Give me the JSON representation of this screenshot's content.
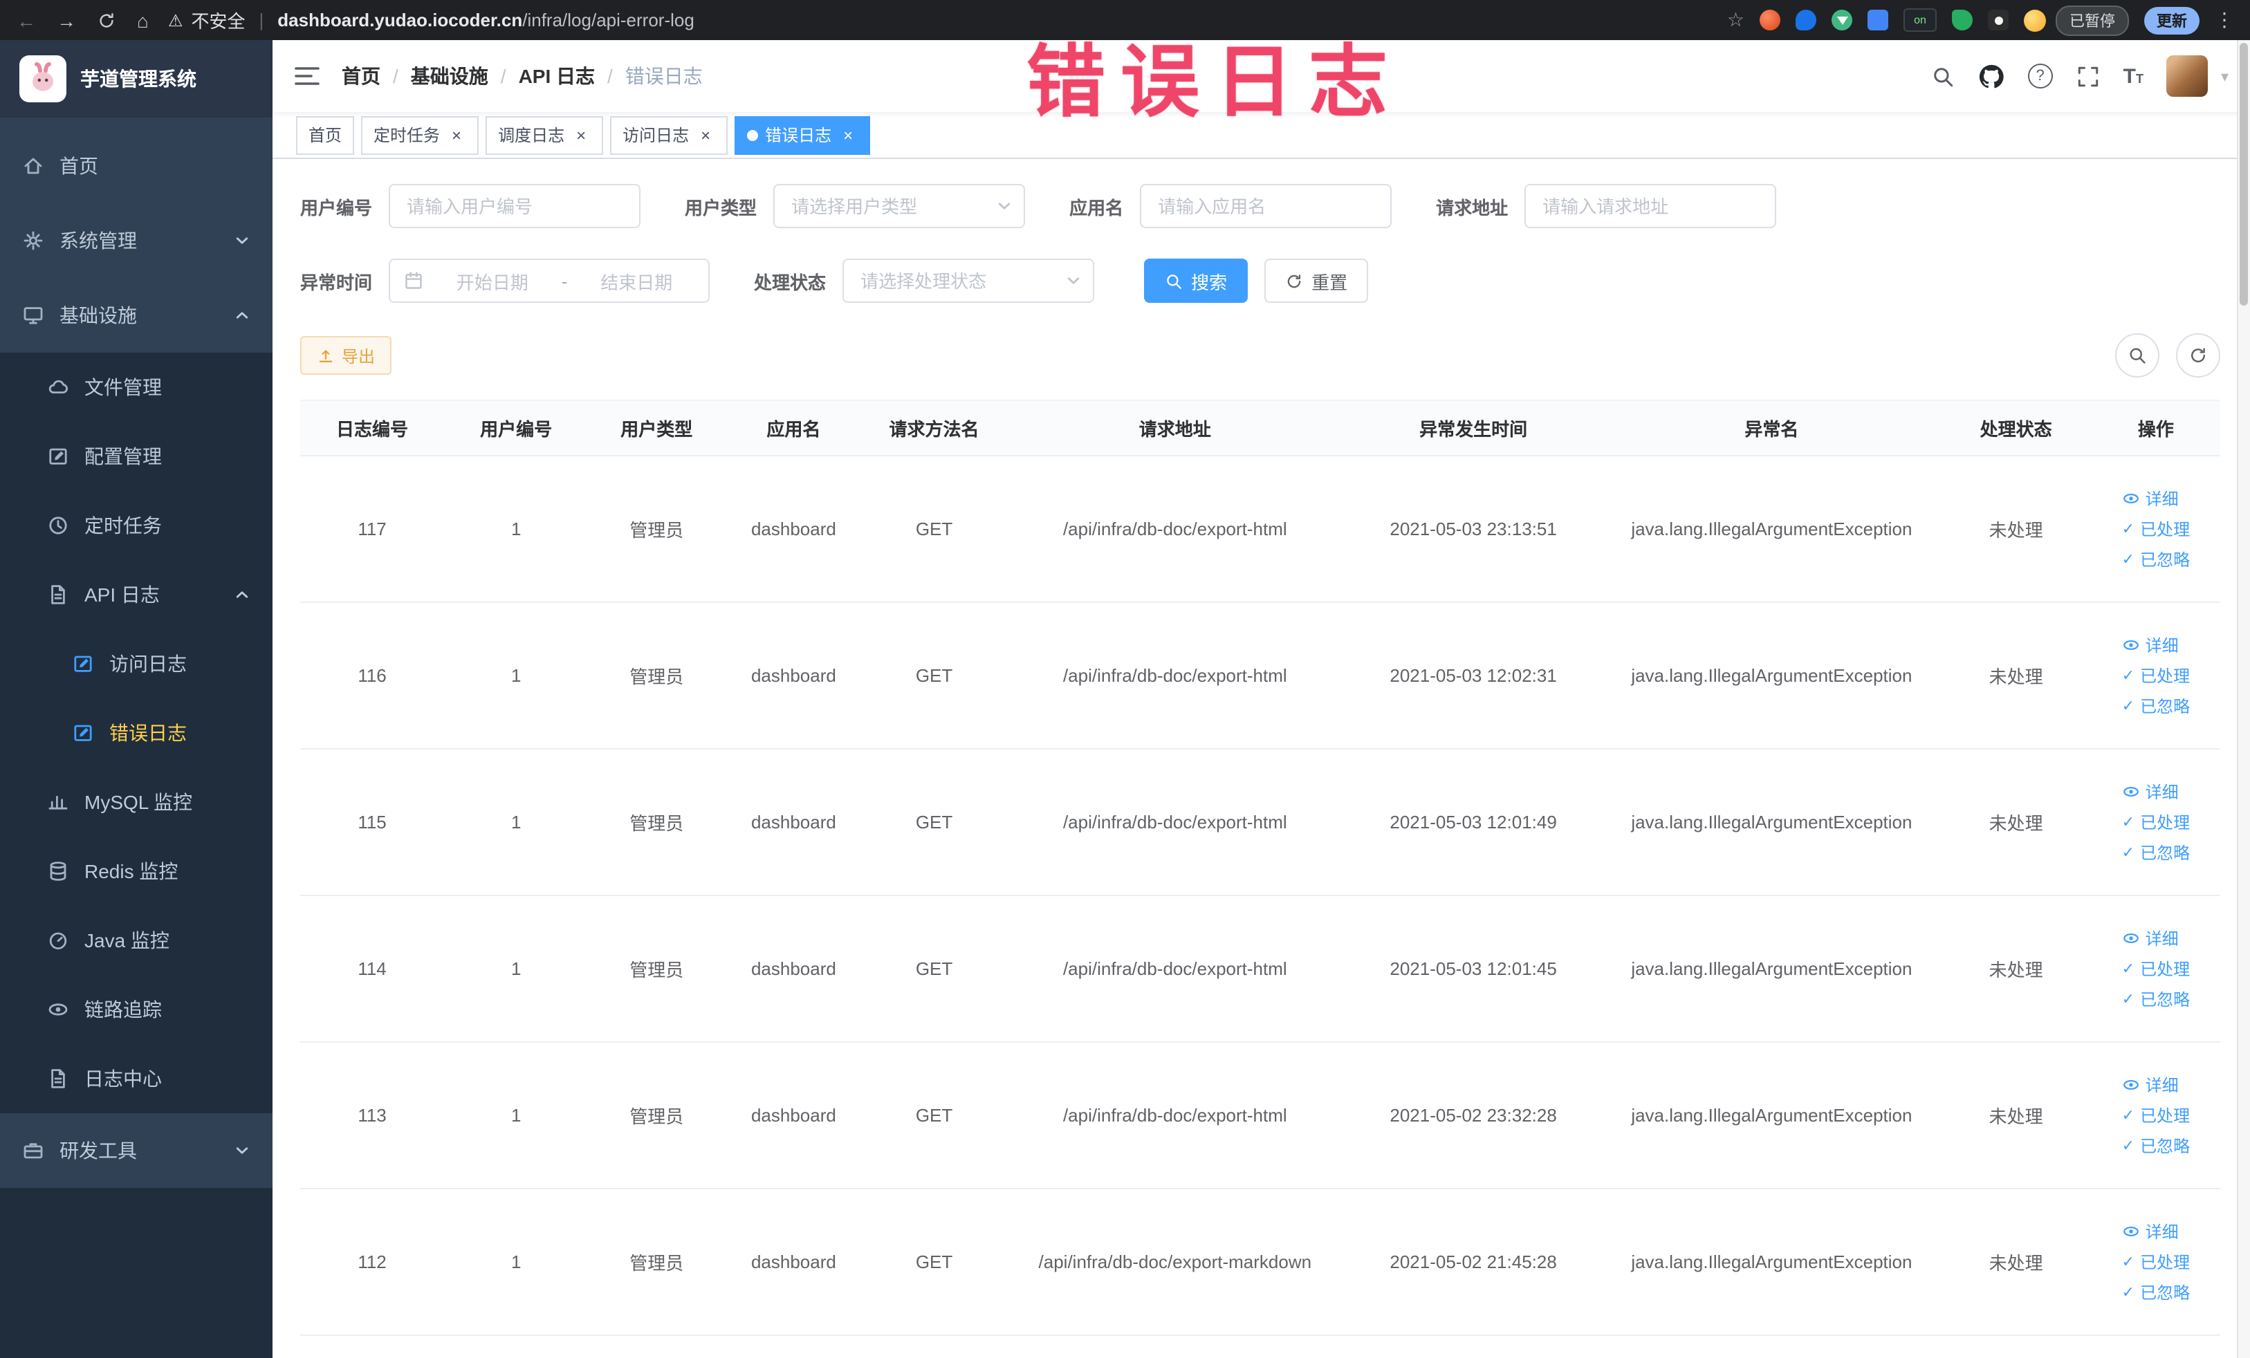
{
  "annotation": {
    "text": "错误日志"
  },
  "colors": {
    "accent": "#409eff",
    "sidebar_bg": "#304156",
    "sidebar_submenu_bg": "#1f2d3d",
    "sidebar_active_text": "#ffd04b",
    "warning": "#e6a23c",
    "annotation_red": "#ee3c61",
    "chrome_bg": "#202124"
  },
  "icons": {
    "back": "←",
    "forward": "→",
    "home": "⌂",
    "warning": "⚠",
    "star": "☆",
    "kebab": "⋮",
    "close": "×",
    "check": "✓",
    "caret": "▾",
    "question": "?",
    "font_size": "T"
  },
  "browser": {
    "security_label": "不安全",
    "divider": "|",
    "url_domain": "dashboard.yudao.iocoder.cn",
    "url_path": "/infra/log/api-error-log",
    "extension_on_badge": "on",
    "paused_badge": "已暂停",
    "update_button": "更新"
  },
  "sidebar": {
    "logo_title": "芋道管理系统",
    "items": {
      "home": "首页",
      "system": "系统管理",
      "infra": "基础设施",
      "file": "文件管理",
      "config": "配置管理",
      "cron": "定时任务",
      "api_log": "API 日志",
      "access_log": "访问日志",
      "error_log": "错误日志",
      "mysql": "MySQL 监控",
      "redis": "Redis 监控",
      "java": "Java 监控",
      "trace": "链路追踪",
      "log_center": "日志中心",
      "devtools": "研发工具"
    }
  },
  "header": {
    "breadcrumb": [
      "首页",
      "基础设施",
      "API 日志",
      "错误日志"
    ],
    "breadcrumb_separator": "/"
  },
  "tabs": [
    {
      "label": "首页"
    },
    {
      "label": "定时任务"
    },
    {
      "label": "调度日志"
    },
    {
      "label": "访问日志"
    },
    {
      "label": "错误日志"
    }
  ],
  "filters": {
    "user_id_label": "用户编号",
    "user_id_placeholder": "请输入用户编号",
    "user_type_label": "用户类型",
    "user_type_placeholder": "请选择用户类型",
    "app_name_label": "应用名",
    "app_name_placeholder": "请输入应用名",
    "request_url_label": "请求地址",
    "request_url_placeholder": "请输入请求地址",
    "time_label": "异常时间",
    "time_start_placeholder": "开始日期",
    "time_separator": "-",
    "time_end_placeholder": "结束日期",
    "status_label": "处理状态",
    "status_placeholder": "请选择处理状态",
    "search_button": "搜索",
    "reset_button": "重置"
  },
  "toolbar": {
    "export_label": "导出"
  },
  "table": {
    "columns": [
      "日志编号",
      "用户编号",
      "用户类型",
      "应用名",
      "请求方法名",
      "请求地址",
      "异常发生时间",
      "异常名",
      "处理状态",
      "操作"
    ],
    "action_labels": {
      "detail": "详细",
      "processed": "已处理",
      "ignored": "已忽略"
    },
    "rows": [
      {
        "log_id": "117",
        "user_id": "1",
        "user_type": "管理员",
        "app_name": "dashboard",
        "method": "GET",
        "url": "/api/infra/db-doc/export-html",
        "time": "2021-05-03 23:13:51",
        "exception": "java.lang.IllegalArgumentException",
        "status": "未处理"
      },
      {
        "log_id": "116",
        "user_id": "1",
        "user_type": "管理员",
        "app_name": "dashboard",
        "method": "GET",
        "url": "/api/infra/db-doc/export-html",
        "time": "2021-05-03 12:02:31",
        "exception": "java.lang.IllegalArgumentException",
        "status": "未处理"
      },
      {
        "log_id": "115",
        "user_id": "1",
        "user_type": "管理员",
        "app_name": "dashboard",
        "method": "GET",
        "url": "/api/infra/db-doc/export-html",
        "time": "2021-05-03 12:01:49",
        "exception": "java.lang.IllegalArgumentException",
        "status": "未处理"
      },
      {
        "log_id": "114",
        "user_id": "1",
        "user_type": "管理员",
        "app_name": "dashboard",
        "method": "GET",
        "url": "/api/infra/db-doc/export-html",
        "time": "2021-05-03 12:01:45",
        "exception": "java.lang.IllegalArgumentException",
        "status": "未处理"
      },
      {
        "log_id": "113",
        "user_id": "1",
        "user_type": "管理员",
        "app_name": "dashboard",
        "method": "GET",
        "url": "/api/infra/db-doc/export-html",
        "time": "2021-05-02 23:32:28",
        "exception": "java.lang.IllegalArgumentException",
        "status": "未处理"
      },
      {
        "log_id": "112",
        "user_id": "1",
        "user_type": "管理员",
        "app_name": "dashboard",
        "method": "GET",
        "url": "/api/infra/db-doc/export-markdown",
        "time": "2021-05-02 21:45:28",
        "exception": "java.lang.IllegalArgumentException",
        "status": "未处理"
      }
    ]
  }
}
